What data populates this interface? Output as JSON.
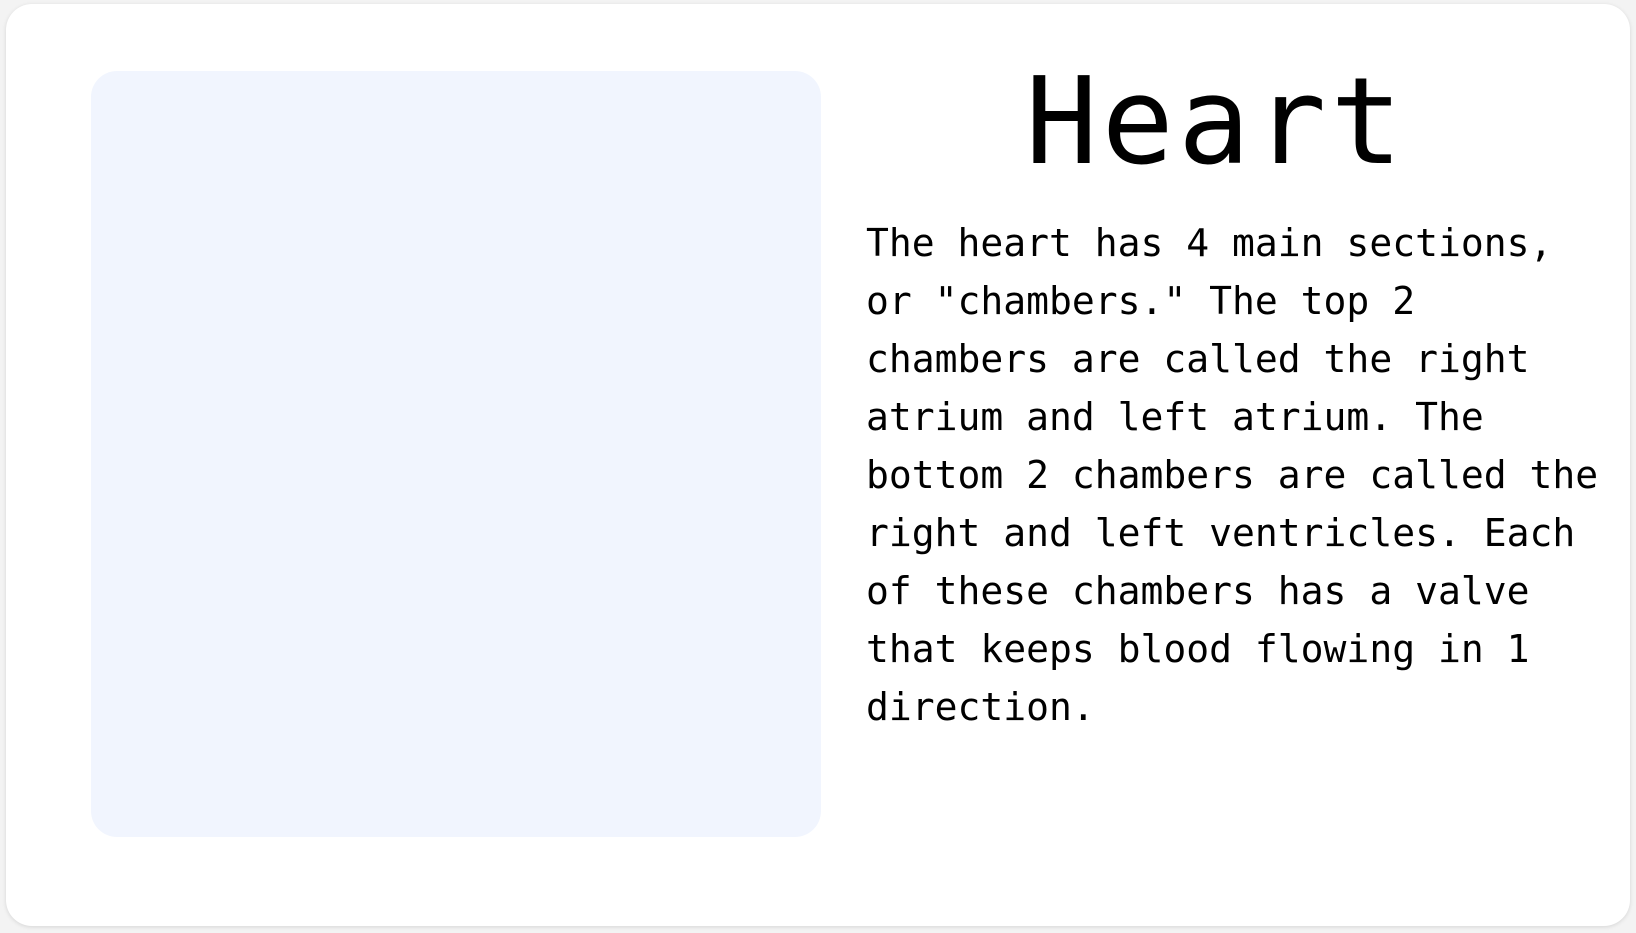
{
  "slide": {
    "title": "Heart",
    "body": "The heart has 4 main sections, or \"chambers.\" The top 2 chambers are called the right atrium and left atrium. The bottom 2 chambers are called the right and left ventricles. Each of these chambers has a valve that keeps blood flowing in 1 direction."
  },
  "colors": {
    "card_background": "#ffffff",
    "image_placeholder": "#f1f5fe",
    "text": "#000000"
  }
}
